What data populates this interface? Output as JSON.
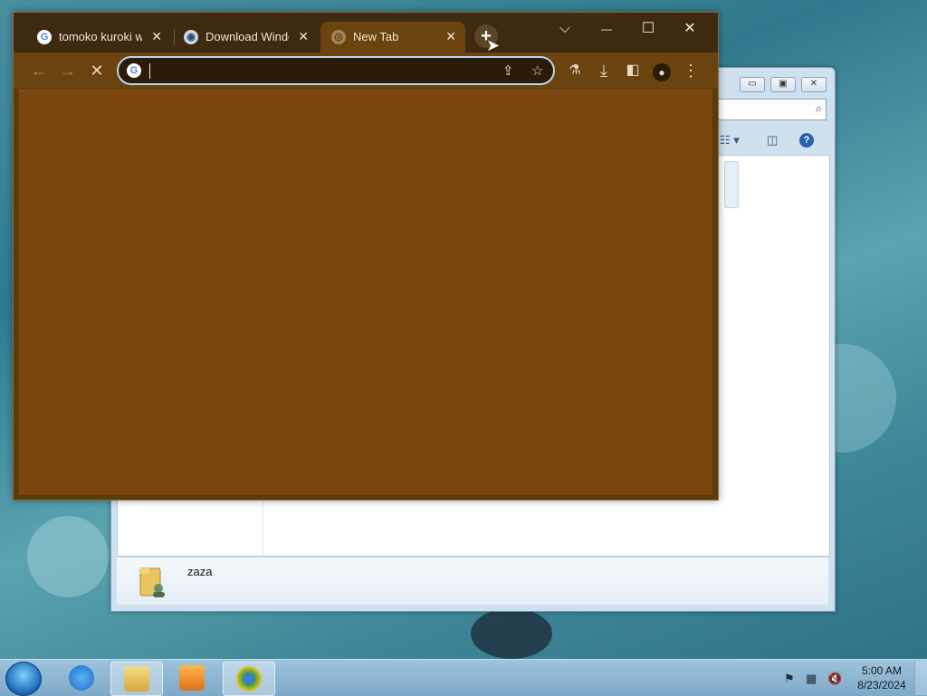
{
  "chrome": {
    "tabs": [
      {
        "title": "tomoko kuroki wa",
        "favicon": "google-icon",
        "active": false
      },
      {
        "title": "Download Windo",
        "favicon": "globe-icon",
        "active": false
      },
      {
        "title": "New Tab",
        "favicon": "chrome-icon",
        "active": true
      }
    ],
    "tab_close_glyph": "✕",
    "new_tab_glyph": "+",
    "window_controls": {
      "dropdown": "⌵",
      "minimize": "—",
      "maximize": "☐",
      "close": "✕"
    },
    "toolbar": {
      "back": "←",
      "forward": "→",
      "stop": "✕"
    },
    "omnibox": {
      "value": "",
      "placeholder": ""
    },
    "colors": {
      "frame": "#3e2a10",
      "toolbar": "#6b430f",
      "content": "#7a460e"
    }
  },
  "explorer": {
    "details_item": "zaza"
  },
  "taskbar": {
    "apps": [
      "internet-explorer-icon",
      "windows-explorer-icon",
      "media-player-icon",
      "chrome-icon"
    ],
    "clock_time": "5:00 AM",
    "clock_date": "8/23/2024"
  }
}
